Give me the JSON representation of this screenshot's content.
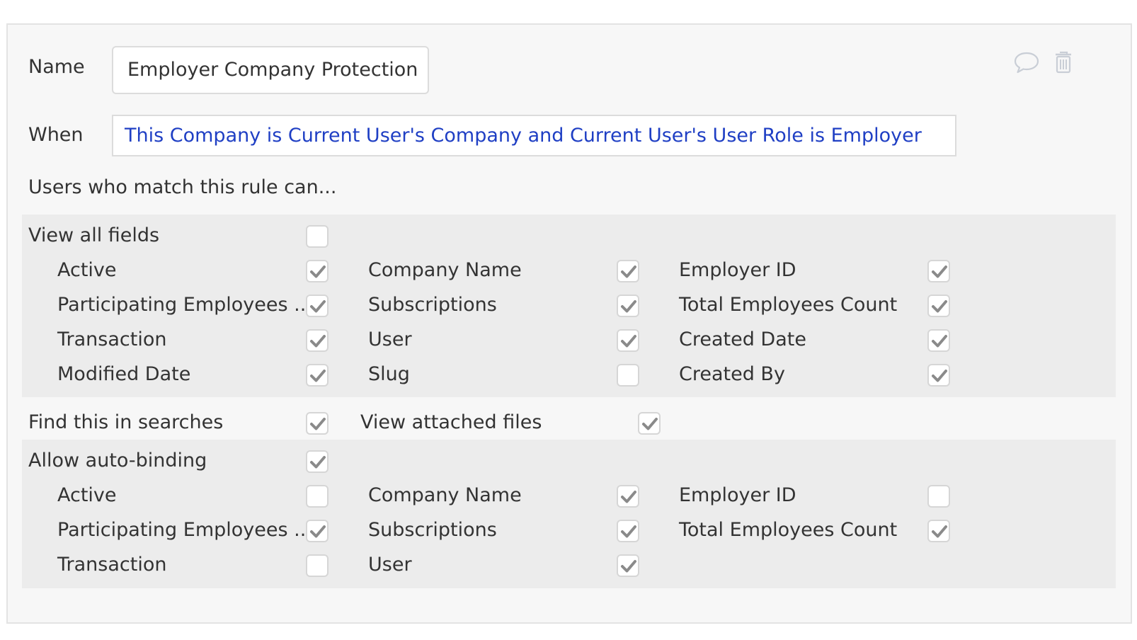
{
  "name_label": "Name",
  "name_value": "Employer Company Protection",
  "when_label": "When",
  "when_expression": "This Company is Current User's Company and Current User's User Role is Employer",
  "intro": "Users who match this rule can...",
  "view_all": {
    "label": "View all fields",
    "checked": false
  },
  "view_fields": [
    {
      "label": "Active",
      "checked": true
    },
    {
      "label": "Company Name",
      "checked": true
    },
    {
      "label": "Employer ID",
      "checked": true
    },
    {
      "label": "Participating Employees ...",
      "checked": true
    },
    {
      "label": "Subscriptions",
      "checked": true
    },
    {
      "label": "Total Employees Count",
      "checked": true
    },
    {
      "label": "Transaction",
      "checked": true
    },
    {
      "label": "User",
      "checked": true
    },
    {
      "label": "Created Date",
      "checked": true
    },
    {
      "label": "Modified Date",
      "checked": true
    },
    {
      "label": "Slug",
      "checked": false
    },
    {
      "label": "Created By",
      "checked": true
    }
  ],
  "find_searches": {
    "label": "Find this in searches",
    "checked": true
  },
  "attached_files": {
    "label": "View attached files",
    "checked": true
  },
  "auto_binding": {
    "label": "Allow auto-binding",
    "checked": true
  },
  "auto_fields": [
    {
      "label": "Active",
      "checked": false
    },
    {
      "label": "Company Name",
      "checked": true
    },
    {
      "label": "Employer ID",
      "checked": false
    },
    {
      "label": "Participating Employees ...",
      "checked": true
    },
    {
      "label": "Subscriptions",
      "checked": true
    },
    {
      "label": "Total Employees Count",
      "checked": true
    },
    {
      "label": "Transaction",
      "checked": false
    },
    {
      "label": "User",
      "checked": true
    }
  ],
  "icons": {
    "comment": "comment-icon",
    "delete": "trash-icon"
  },
  "colors": {
    "link_text": "#1f3fc4",
    "checkmark": "#8a8a8a",
    "panel_bg": "#f7f7f7",
    "section_bg": "#ececec"
  }
}
